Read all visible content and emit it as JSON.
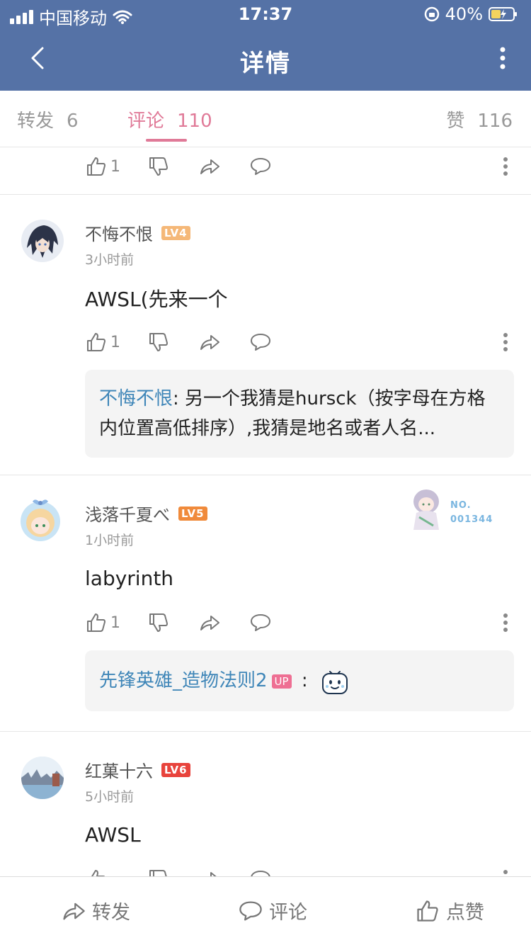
{
  "status": {
    "carrier": "中国移动",
    "time": "17:37",
    "battery": "40%"
  },
  "nav": {
    "title": "详情",
    "back_icon": "back-arrow-icon",
    "more_icon": "more-vertical-icon"
  },
  "tabs": {
    "forward": {
      "label": "转发",
      "count": "6"
    },
    "comment": {
      "label": "评论",
      "count": "110"
    },
    "like": {
      "label": "赞",
      "count": "116"
    }
  },
  "top_actions": {
    "likes": "1"
  },
  "comments": [
    {
      "user": "不悔不恨",
      "level": "LV4",
      "time": "3小时前",
      "text": "AWSL(先来一个",
      "likes": "1",
      "reply": {
        "user": "不悔不恨",
        "sep": ":",
        "text": " 另一个我猜是hursck（按字母在方格内位置高低排序）,我猜是地名或者人名..."
      }
    },
    {
      "user": "浅落千夏べ",
      "level": "LV5",
      "time": "1小时前",
      "text": "labyrinth",
      "likes": "1",
      "badge": {
        "line1": "NO.",
        "line2": "001344"
      },
      "reply": {
        "user": "先锋英雄_造物法则2",
        "up": "UP",
        "sep": " :"
      }
    },
    {
      "user": "红菓十六",
      "level": "LV6",
      "time": "5小时前",
      "text": "AWSL"
    }
  ],
  "bottom": {
    "forward": "转发",
    "comment": "评论",
    "like": "点赞"
  },
  "colors": {
    "header": "#5572a6",
    "accent": "#e07a98",
    "link": "#3f86b8"
  }
}
